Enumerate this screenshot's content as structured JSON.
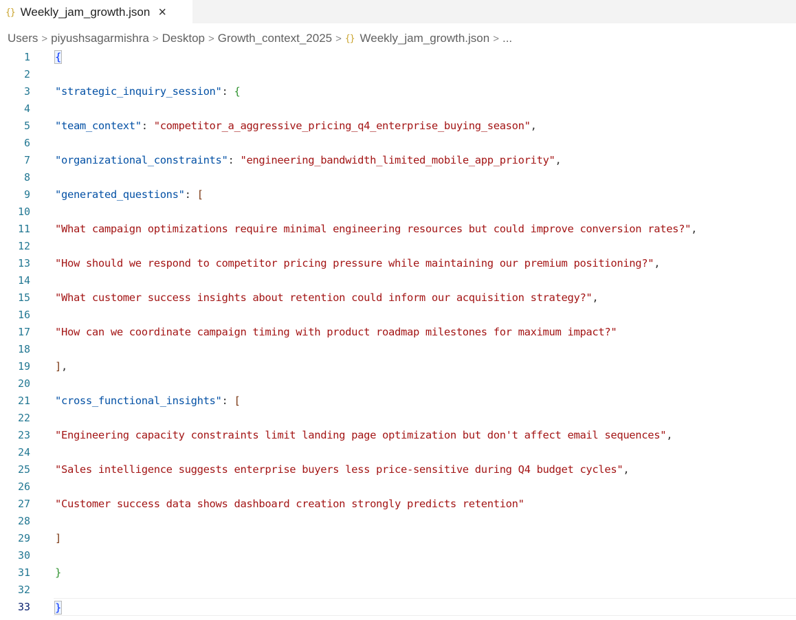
{
  "tab": {
    "icon": "{}",
    "title": "Weekly_jam_growth.json",
    "close_label": "×"
  },
  "breadcrumb": {
    "items": [
      "Users",
      "piyushsagarmishra",
      "Desktop",
      "Growth_context_2025"
    ],
    "file_icon": "{}",
    "file": "Weekly_jam_growth.json",
    "more": "..."
  },
  "editor": {
    "lines": [
      {
        "n": "1",
        "tokens": [
          {
            "t": "{",
            "c": "b1"
          }
        ]
      },
      {
        "n": "2",
        "tokens": []
      },
      {
        "n": "3",
        "tokens": [
          {
            "t": "\"strategic_inquiry_session\"",
            "c": "k"
          },
          {
            "t": ": ",
            "c": "p"
          },
          {
            "t": "{",
            "c": "b2"
          }
        ]
      },
      {
        "n": "4",
        "tokens": []
      },
      {
        "n": "5",
        "tokens": [
          {
            "t": "\"team_context\"",
            "c": "k"
          },
          {
            "t": ": ",
            "c": "p"
          },
          {
            "t": "\"competitor_a_aggressive_pricing_q4_enterprise_buying_season\"",
            "c": "s"
          },
          {
            "t": ",",
            "c": "p"
          }
        ]
      },
      {
        "n": "6",
        "tokens": []
      },
      {
        "n": "7",
        "tokens": [
          {
            "t": "\"organizational_constraints\"",
            "c": "k"
          },
          {
            "t": ": ",
            "c": "p"
          },
          {
            "t": "\"engineering_bandwidth_limited_mobile_app_priority\"",
            "c": "s"
          },
          {
            "t": ",",
            "c": "p"
          }
        ]
      },
      {
        "n": "8",
        "tokens": []
      },
      {
        "n": "9",
        "tokens": [
          {
            "t": "\"generated_questions\"",
            "c": "k"
          },
          {
            "t": ": ",
            "c": "p"
          },
          {
            "t": "[",
            "c": "b3"
          }
        ]
      },
      {
        "n": "10",
        "tokens": []
      },
      {
        "n": "11",
        "tokens": [
          {
            "t": "\"What campaign optimizations require minimal engineering resources but could improve conversion rates?\"",
            "c": "s"
          },
          {
            "t": ",",
            "c": "p"
          }
        ]
      },
      {
        "n": "12",
        "tokens": []
      },
      {
        "n": "13",
        "tokens": [
          {
            "t": "\"How should we respond to competitor pricing pressure while maintaining our premium positioning?\"",
            "c": "s"
          },
          {
            "t": ",",
            "c": "p"
          }
        ]
      },
      {
        "n": "14",
        "tokens": []
      },
      {
        "n": "15",
        "tokens": [
          {
            "t": "\"What customer success insights about retention could inform our acquisition strategy?\"",
            "c": "s"
          },
          {
            "t": ",",
            "c": "p"
          }
        ]
      },
      {
        "n": "16",
        "tokens": []
      },
      {
        "n": "17",
        "tokens": [
          {
            "t": "\"How can we coordinate campaign timing with product roadmap milestones for maximum impact?\"",
            "c": "s"
          }
        ]
      },
      {
        "n": "18",
        "tokens": []
      },
      {
        "n": "19",
        "tokens": [
          {
            "t": "]",
            "c": "b3"
          },
          {
            "t": ",",
            "c": "p"
          }
        ]
      },
      {
        "n": "20",
        "tokens": []
      },
      {
        "n": "21",
        "tokens": [
          {
            "t": "\"cross_functional_insights\"",
            "c": "k"
          },
          {
            "t": ": ",
            "c": "p"
          },
          {
            "t": "[",
            "c": "b3"
          }
        ]
      },
      {
        "n": "22",
        "tokens": []
      },
      {
        "n": "23",
        "tokens": [
          {
            "t": "\"Engineering capacity constraints limit landing page optimization but don't affect email sequences\"",
            "c": "s"
          },
          {
            "t": ",",
            "c": "p"
          }
        ]
      },
      {
        "n": "24",
        "tokens": []
      },
      {
        "n": "25",
        "tokens": [
          {
            "t": "\"Sales intelligence suggests enterprise buyers less price-sensitive during Q4 budget cycles\"",
            "c": "s"
          },
          {
            "t": ",",
            "c": "p"
          }
        ]
      },
      {
        "n": "26",
        "tokens": []
      },
      {
        "n": "27",
        "tokens": [
          {
            "t": "\"Customer success data shows dashboard creation strongly predicts retention\"",
            "c": "s"
          }
        ]
      },
      {
        "n": "28",
        "tokens": []
      },
      {
        "n": "29",
        "tokens": [
          {
            "t": "]",
            "c": "b3"
          }
        ]
      },
      {
        "n": "30",
        "tokens": []
      },
      {
        "n": "31",
        "tokens": [
          {
            "t": "}",
            "c": "b2"
          }
        ]
      },
      {
        "n": "32",
        "tokens": []
      },
      {
        "n": "33",
        "tokens": [
          {
            "t": "}",
            "c": "b1"
          }
        ]
      }
    ],
    "active_line": "33",
    "colors": {
      "key": "#0451a5",
      "string": "#a31515",
      "line_number": "#237893",
      "bracket_1": "#0431fa",
      "bracket_2": "#319331",
      "bracket_3": "#7b3814"
    }
  }
}
